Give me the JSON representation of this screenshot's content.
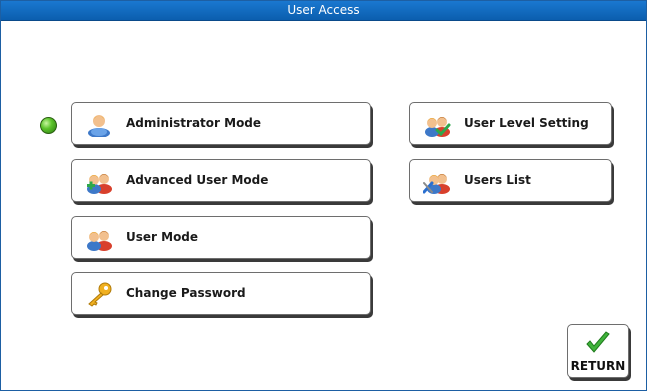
{
  "window": {
    "title": "User Access"
  },
  "status": {
    "active_indicator_color": "#5cc42b"
  },
  "left_buttons": [
    {
      "label": "Administrator Mode",
      "icon": "admin-user-icon"
    },
    {
      "label": "Advanced User Mode",
      "icon": "advanced-users-icon"
    },
    {
      "label": "User Mode",
      "icon": "users-icon"
    },
    {
      "label": "Change Password",
      "icon": "key-icon"
    }
  ],
  "right_buttons": [
    {
      "label": "User Level Setting",
      "icon": "user-level-icon"
    },
    {
      "label": "Users List",
      "icon": "users-list-icon"
    }
  ],
  "return_button": {
    "label": "RETURN",
    "icon": "checkmark-icon"
  }
}
